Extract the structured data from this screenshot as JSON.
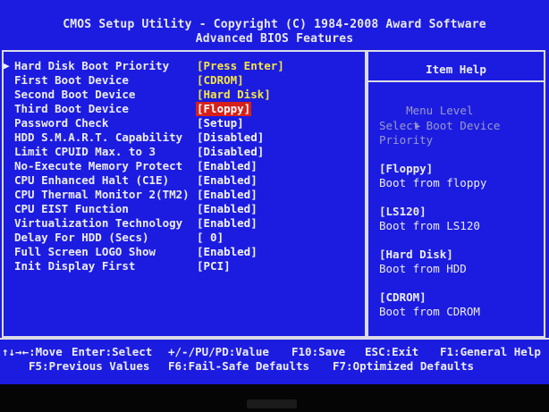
{
  "header": {
    "line1": "CMOS Setup Utility - Copyright (C) 1984-2008 Award Software",
    "line2": "Advanced BIOS Features"
  },
  "settings": [
    {
      "label": "Hard Disk Boot Priority",
      "value": "[Press Enter]",
      "submenu": true,
      "arrow": "▶"
    },
    {
      "label": "First Boot Device",
      "value": "[CDROM]"
    },
    {
      "label": "Second Boot Device",
      "value": "[Hard Disk]"
    },
    {
      "label": "Third Boot Device",
      "value": "[Floppy]",
      "selected": true
    },
    {
      "label": "Password Check",
      "value": "[Setup]"
    },
    {
      "label": "HDD S.M.A.R.T. Capability",
      "value": "[Disabled]"
    },
    {
      "label": "Limit CPUID Max. to 3",
      "value": "[Disabled]"
    },
    {
      "label": "No-Execute Memory Protect",
      "value": "[Enabled]"
    },
    {
      "label": "CPU Enhanced Halt (C1E)",
      "value": "[Enabled]"
    },
    {
      "label": "CPU Thermal Monitor 2(TM2)",
      "value": "[Enabled]"
    },
    {
      "label": "CPU EIST Function",
      "value": "[Enabled]"
    },
    {
      "label": "Virtualization Technology",
      "value": "[Enabled]"
    },
    {
      "label": "Delay For HDD (Secs)",
      "value": "[ 0]"
    },
    {
      "label": "Full Screen LOGO Show",
      "value": "[Enabled]"
    },
    {
      "label": "Init Display First",
      "value": "[PCI]"
    }
  ],
  "help": {
    "title": "Item Help",
    "menu_level": "Menu Level",
    "menu_level_arrow": "▶",
    "description_1": "Select Boot Device",
    "description_2": "Priority",
    "options": [
      {
        "key": "[Floppy]",
        "desc": "Boot from floppy"
      },
      {
        "key": "[LS120]",
        "desc": "Boot from LS120"
      },
      {
        "key": "[Hard Disk]",
        "desc": "Boot from HDD"
      },
      {
        "key": "[CDROM]",
        "desc": "Boot from CDROM"
      }
    ]
  },
  "footer": {
    "move": "↑↓→←:Move",
    "enter": "Enter:Select",
    "value": "+/-/PU/PD:Value",
    "save": "F10:Save",
    "exit": "ESC:Exit",
    "general_help": "F1:General Help",
    "previous": "F5:Previous Values",
    "failsafe": "F6:Fail-Safe Defaults",
    "optimized": "F7:Optimized Defaults"
  },
  "colors": {
    "background": "#1c1ce0",
    "text": "#ececf4",
    "value_highlight": "#f6e640",
    "selection": "#d8201a",
    "dim_text": "#9a9ac8"
  }
}
